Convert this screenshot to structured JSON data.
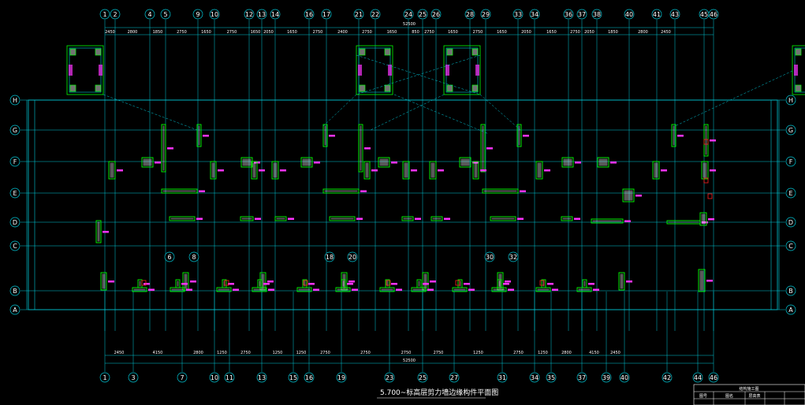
{
  "drawing_title": "5.700~标高层剪力墙边缘构件平面图",
  "axes": {
    "top_numbers": [
      "1",
      "2",
      "4",
      "5",
      "9",
      "10",
      "12",
      "13",
      "14",
      "16",
      "17",
      "21",
      "22",
      "24",
      "25",
      "26",
      "28",
      "29",
      "33",
      "34",
      "36",
      "37",
      "38",
      "40",
      "41",
      "43",
      "45",
      "46"
    ],
    "bottom_numbers": [
      "1",
      "3",
      "7",
      "10",
      "11",
      "13",
      "15",
      "16",
      "19",
      "23",
      "25",
      "27",
      "31",
      "34",
      "35",
      "37",
      "39",
      "40",
      "42",
      "44",
      "46"
    ],
    "row_letters": [
      "H",
      "G",
      "F",
      "E",
      "D",
      "C",
      "B",
      "A"
    ],
    "mid_markers": [
      "6",
      "8",
      "18",
      "20",
      "30",
      "32"
    ]
  },
  "colors": {
    "background": "#000000",
    "grid_line": "#00c8d8",
    "dim_line": "#00c8d8",
    "column_outline": "#00ff00",
    "hatch": "#ffffff",
    "tag": "#ff33ff",
    "accent_red": "#ff2020",
    "text": "#ffffff"
  },
  "dims_top": [
    "2450",
    "2800",
    "1850",
    "2750",
    "1650",
    "2750",
    "1650",
    "2050",
    "1650",
    "2750",
    "2400",
    "2750",
    "1650",
    "850",
    "2750",
    "1650",
    "2750",
    "1650",
    "2050",
    "1650",
    "2750",
    "2050",
    "1850",
    "2800",
    "2450"
  ],
  "dims_bottom": [
    "2450",
    "4150",
    "2800",
    "1250",
    "2750",
    "1250",
    "1250",
    "2750",
    "2750",
    "2750",
    "2750",
    "1250",
    "2750",
    "1250",
    "2800",
    "4150",
    "2450"
  ],
  "overall_dim": "52500",
  "title_block": {
    "header": "结构施工图",
    "cells": [
      "图号",
      "图名",
      "层高表"
    ]
  }
}
